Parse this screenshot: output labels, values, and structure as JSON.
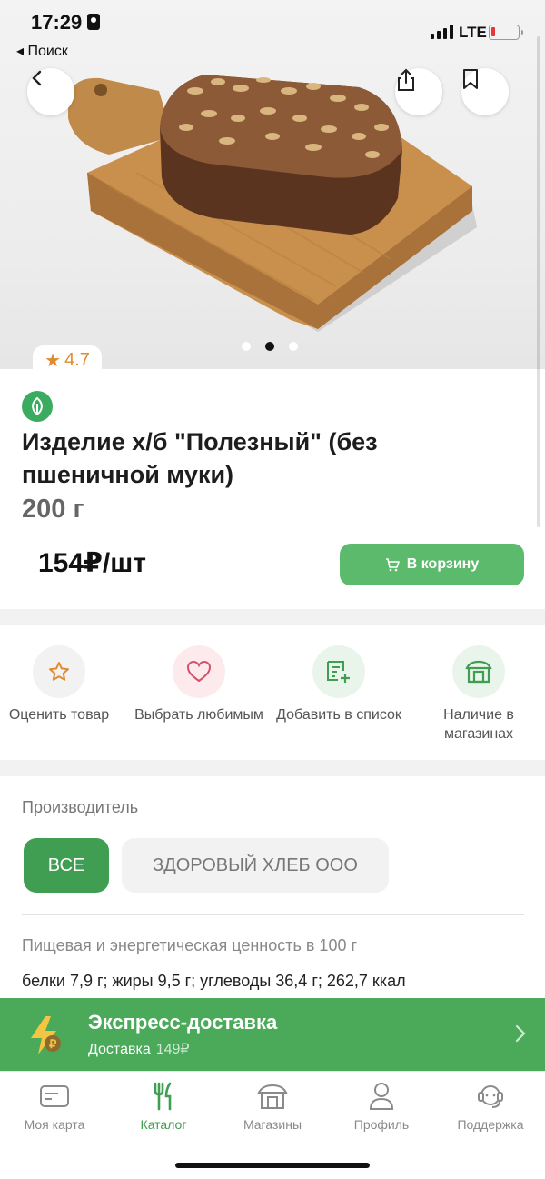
{
  "status_bar": {
    "time": "17:29",
    "back_app": "◂ Поиск",
    "network": "LTE"
  },
  "hero": {
    "page_count": 3,
    "active_page": 2
  },
  "product": {
    "rating": "4.7",
    "title": "Изделие х/б \"Полезный\" (без пшеничной муки)",
    "weight": "200 г",
    "price": "154₽/шт",
    "cart_label": "В корзину"
  },
  "actions": [
    {
      "label": "Оценить товар",
      "icon": "star-icon"
    },
    {
      "label": "Выбрать любимым",
      "icon": "heart-icon"
    },
    {
      "label": "Добавить в список",
      "icon": "add-list-icon"
    },
    {
      "label": "Наличие в магазинах",
      "icon": "store-icon"
    }
  ],
  "manufacturer": {
    "title": "Производитель",
    "all_label": "ВСЕ",
    "brand_label": "ЗДОРОВЫЙ ХЛЕБ ООО"
  },
  "nutrition": {
    "title": "Пищевая и энергетическая ценность в 100 г",
    "values": "белки 7,9 г; жиры 9,5 г; углеводы 36,4 г; 262,7 ккал"
  },
  "express": {
    "title": "Экспресс-доставка",
    "subtitle": "Доставка",
    "fee": "149₽"
  },
  "tabs": [
    {
      "label": "Моя карта",
      "icon": "card-icon",
      "active": false
    },
    {
      "label": "Каталог",
      "icon": "fork-knife-icon",
      "active": true
    },
    {
      "label": "Магазины",
      "icon": "store-icon",
      "active": false
    },
    {
      "label": "Профиль",
      "icon": "profile-icon",
      "active": false
    },
    {
      "label": "Поддержка",
      "icon": "headset-icon",
      "active": false
    }
  ],
  "colors": {
    "accent": "#4aaa5a",
    "button": "#5cba6d",
    "rating": "#e18b2f"
  }
}
